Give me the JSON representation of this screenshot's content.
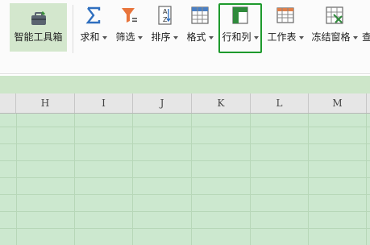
{
  "toolbar": {
    "toolbox_label": "智能工具箱",
    "sum_label": "求和",
    "filter_label": "筛选",
    "sort_label": "排序",
    "format_label": "格式",
    "rows_cols_label": "行和列",
    "worksheet_label": "工作表",
    "freeze_label": "冻结窗格",
    "overflow_label": "查"
  },
  "grid": {
    "columns": [
      "H",
      "I",
      "J",
      "K",
      "L",
      "M"
    ]
  },
  "colors": {
    "highlight_border": "#1e9a2d",
    "grid_fill": "#cce8cf",
    "toolbox_fill": "#d3e7cd"
  }
}
